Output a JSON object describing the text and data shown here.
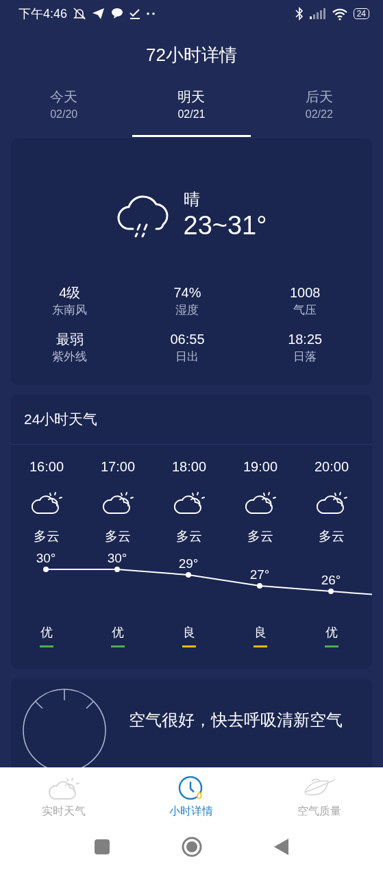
{
  "status_bar": {
    "time": "下午4:46",
    "battery": "24"
  },
  "header": {
    "title": "72小时详情"
  },
  "tabs": [
    {
      "label": "今天",
      "date": "02/20",
      "selected": false
    },
    {
      "label": "明天",
      "date": "02/21",
      "selected": true
    },
    {
      "label": "后天",
      "date": "02/22",
      "selected": false
    }
  ],
  "day_summary": {
    "condition": "晴",
    "temperature": "23~31°",
    "stats": [
      {
        "value": "4级",
        "label": "东南风"
      },
      {
        "value": "74%",
        "label": "湿度"
      },
      {
        "value": "1008",
        "label": "气压"
      },
      {
        "value": "最弱",
        "label": "紫外线"
      },
      {
        "value": "06:55",
        "label": "日出"
      },
      {
        "value": "18:25",
        "label": "日落"
      }
    ]
  },
  "hourly": {
    "title": "24小时天气",
    "hours": [
      {
        "time": "16:00",
        "condition": "多云",
        "temperature": "30°",
        "air": "优",
        "color": "#4caf50"
      },
      {
        "time": "17:00",
        "condition": "多云",
        "temperature": "30°",
        "air": "优",
        "color": "#4caf50"
      },
      {
        "time": "18:00",
        "condition": "多云",
        "temperature": "29°",
        "air": "良",
        "color": "#f5b700"
      },
      {
        "time": "19:00",
        "condition": "多云",
        "temperature": "27°",
        "air": "良",
        "color": "#f5b700"
      },
      {
        "time": "20:00",
        "condition": "多云",
        "temperature": "26°",
        "air": "优",
        "color": "#4caf50"
      }
    ]
  },
  "air_card": {
    "message": "空气很好，快去呼吸清新空气"
  },
  "bottom_nav": [
    {
      "label": "实时天气",
      "selected": false
    },
    {
      "label": "小时详情",
      "selected": true
    },
    {
      "label": "空气质量",
      "selected": false
    }
  ]
}
